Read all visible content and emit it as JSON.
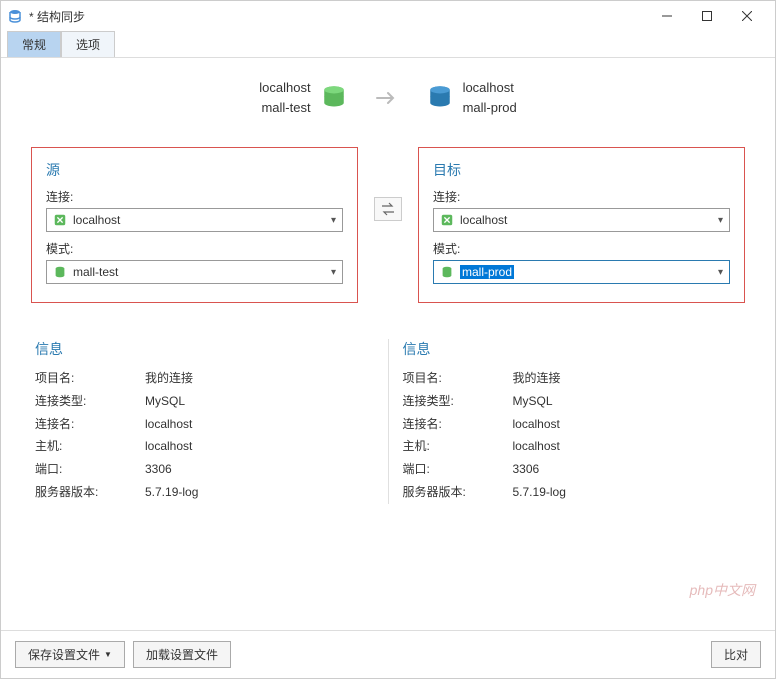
{
  "window": {
    "title": "* 结构同步"
  },
  "tabs": {
    "general": "常规",
    "options": "选项"
  },
  "header": {
    "source_host": "localhost",
    "source_schema": "mall-test",
    "target_host": "localhost",
    "target_schema": "mall-prod"
  },
  "source_panel": {
    "title": "源",
    "connection_label": "连接:",
    "connection_value": "localhost",
    "schema_label": "模式:",
    "schema_value": "mall-test"
  },
  "target_panel": {
    "title": "目标",
    "connection_label": "连接:",
    "connection_value": "localhost",
    "schema_label": "模式:",
    "schema_value": "mall-prod"
  },
  "info_source": {
    "title": "信息",
    "rows": [
      {
        "label": "项目名:",
        "value": "我的连接"
      },
      {
        "label": "连接类型:",
        "value": "MySQL"
      },
      {
        "label": "连接名:",
        "value": "localhost"
      },
      {
        "label": "主机:",
        "value": "localhost"
      },
      {
        "label": "端口:",
        "value": "3306"
      },
      {
        "label": "服务器版本:",
        "value": "5.7.19-log"
      }
    ]
  },
  "info_target": {
    "title": "信息",
    "rows": [
      {
        "label": "项目名:",
        "value": "我的连接"
      },
      {
        "label": "连接类型:",
        "value": "MySQL"
      },
      {
        "label": "连接名:",
        "value": "localhost"
      },
      {
        "label": "主机:",
        "value": "localhost"
      },
      {
        "label": "端口:",
        "value": "3306"
      },
      {
        "label": "服务器版本:",
        "value": "5.7.19-log"
      }
    ]
  },
  "footer": {
    "save_profile": "保存设置文件",
    "load_profile": "加载设置文件",
    "compare": "比对"
  },
  "watermark": "php中文网"
}
